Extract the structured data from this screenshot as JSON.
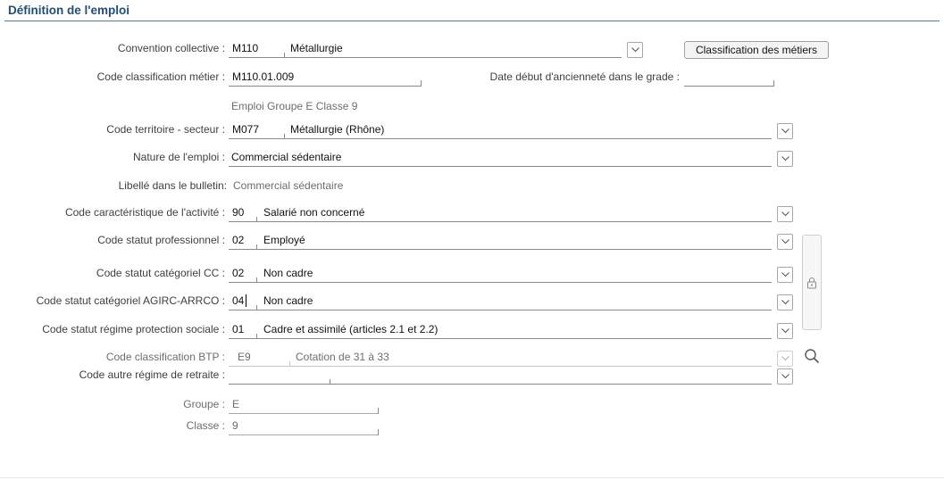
{
  "section_title": "Définition de l'emploi",
  "convention": {
    "label": "Convention collective :",
    "code": "M110",
    "text": "Métallurgie",
    "button": "Classification des métiers"
  },
  "classification_metier": {
    "label": "Code classification métier :",
    "value": "M110.01.009",
    "info": "Emploi Groupe E Classe 9"
  },
  "anciennete": {
    "label": "Date début d'ancienneté dans le grade :",
    "value": ""
  },
  "territoire": {
    "label": "Code territoire - secteur :",
    "code": "M077",
    "text": "Métallurgie (Rhône)"
  },
  "nature": {
    "label": "Nature de l'emploi :",
    "text": "Commercial sédentaire"
  },
  "libelle": {
    "label": "Libellé dans le bulletin:",
    "text": "Commercial sédentaire"
  },
  "activite": {
    "label": "Code caractéristique de l'activité :",
    "code": "90",
    "text": "Salarié non concerné"
  },
  "statut_pro": {
    "label": "Code statut professionnel :",
    "code": "02",
    "text": "Employé"
  },
  "statut_cc": {
    "label": "Code statut catégoriel CC :",
    "code": "02",
    "text": "Non cadre"
  },
  "statut_agirc": {
    "label": "Code statut catégoriel AGIRC-ARRCO :",
    "code": "04",
    "text": "Non cadre"
  },
  "regime_protection": {
    "label": "Code statut régime protection sociale :",
    "code": "01",
    "text": "Cadre et assimilé (articles 2.1 et 2.2)"
  },
  "btp": {
    "label": "Code classification BTP :",
    "code": "E9",
    "text": "Cotation de 31 à 33"
  },
  "retraite": {
    "label": "Code autre régime de retraite :",
    "code": "",
    "text": ""
  },
  "groupe": {
    "label": "Groupe :",
    "value": "E"
  },
  "classe": {
    "label": "Classe :",
    "value": "9"
  },
  "icons": {
    "dropdown": "chevron-down-icon",
    "lock": "lock-icon",
    "search": "search-icon"
  }
}
